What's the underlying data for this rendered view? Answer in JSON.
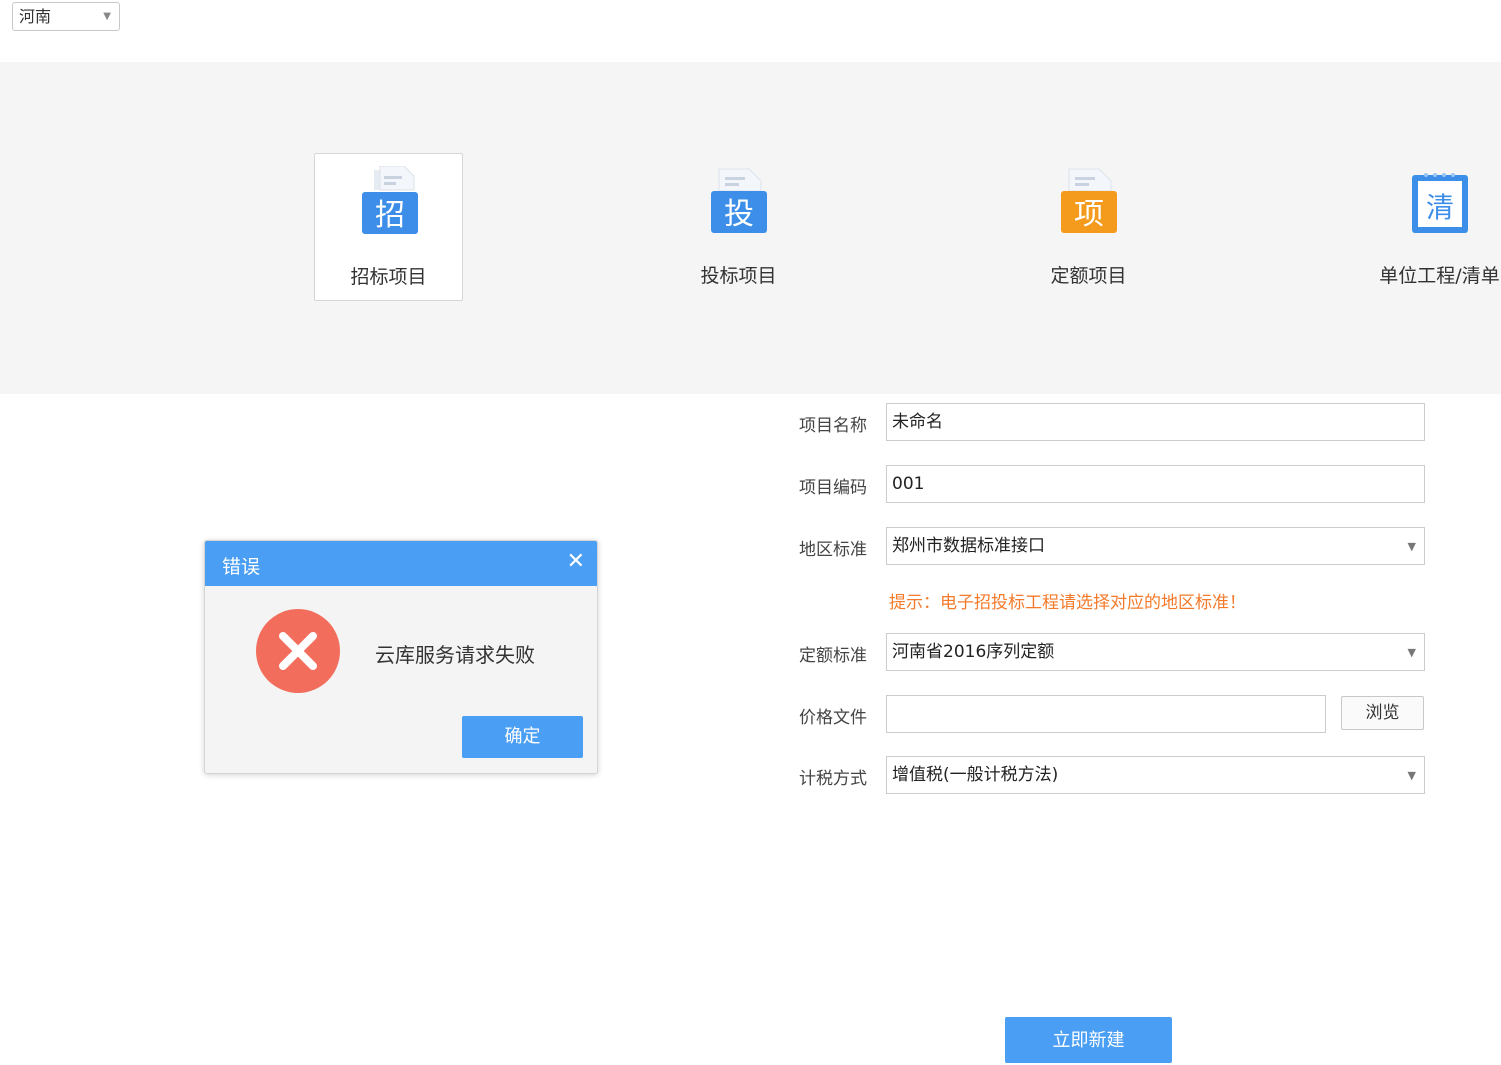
{
  "region": {
    "selected": "河南"
  },
  "project_types": [
    {
      "label": "招标项目",
      "glyph": "招",
      "icon": "tender-project-icon",
      "color": "#3d8ee8",
      "selected": true
    },
    {
      "label": "投标项目",
      "glyph": "投",
      "icon": "bid-project-icon",
      "color": "#3d8ee8",
      "selected": false
    },
    {
      "label": "定额项目",
      "glyph": "项",
      "icon": "quota-project-icon",
      "color": "#f49a1d",
      "selected": false
    },
    {
      "label": "单位工程/清单",
      "glyph": "清",
      "icon": "unit-bill-icon",
      "color": "#3d8ee8",
      "selected": false
    }
  ],
  "form": {
    "project_name": {
      "label": "项目名称",
      "value": "未命名"
    },
    "project_code": {
      "label": "项目编码",
      "value": "001"
    },
    "region_standard": {
      "label": "地区标准",
      "value": "郑州市数据标准接口"
    },
    "hint": "提示：电子招投标工程请选择对应的地区标准！",
    "quota_standard": {
      "label": "定额标准",
      "value": "河南省2016序列定额"
    },
    "price_file": {
      "label": "价格文件",
      "value": "",
      "browse": "浏览"
    },
    "tax_method": {
      "label": "计税方式",
      "value": "增值税(一般计税方法)"
    },
    "create_button": "立即新建"
  },
  "dialog": {
    "title": "错误",
    "message": "云库服务请求失败",
    "ok": "确定"
  },
  "colors": {
    "primary": "#4a9ef3",
    "hint": "#f47a2a",
    "error": "#f26d5b"
  }
}
